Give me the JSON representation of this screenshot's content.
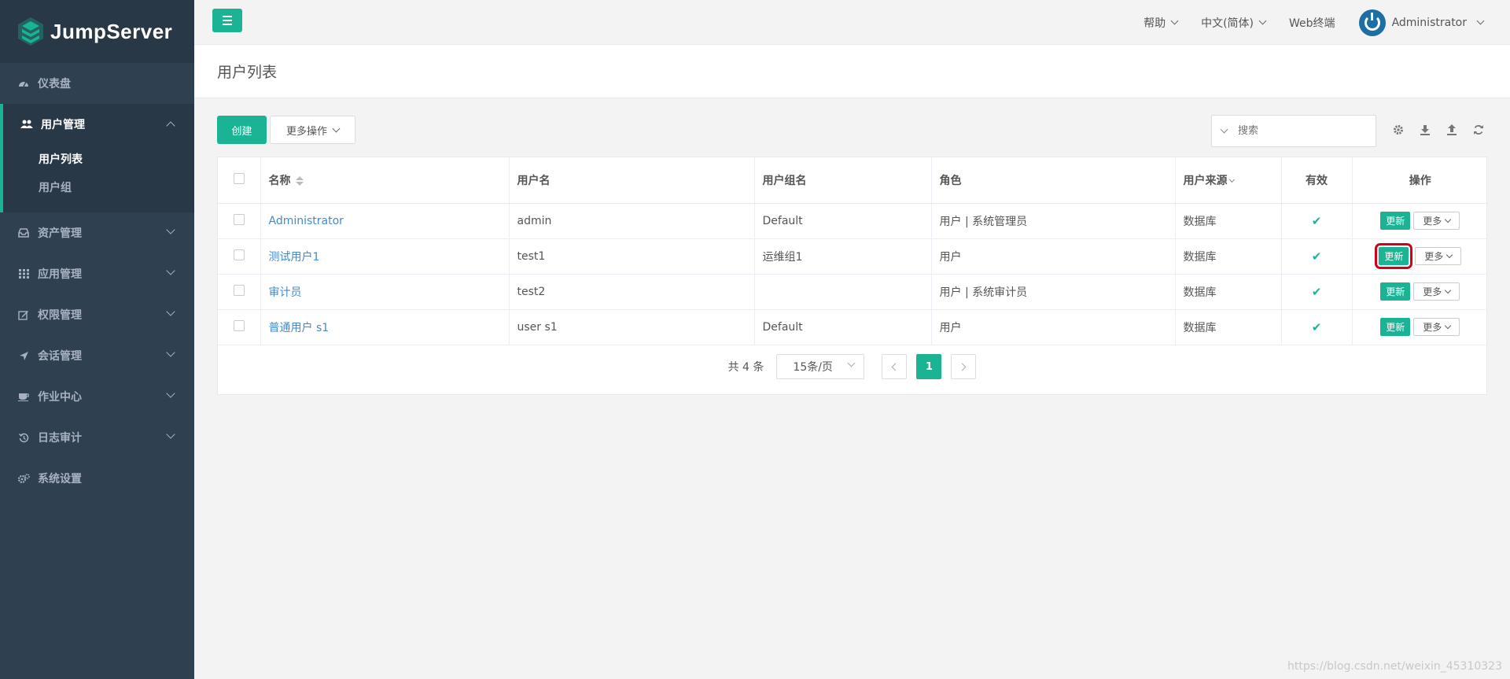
{
  "brand": {
    "name": "JumpServer"
  },
  "sidebar": {
    "items": [
      {
        "label": "仪表盘",
        "icon": "dashboard-icon"
      },
      {
        "label": "用户管理",
        "icon": "users-icon",
        "open": true,
        "children": [
          {
            "label": "用户列表",
            "active": true
          },
          {
            "label": "用户组"
          }
        ]
      },
      {
        "label": "资产管理",
        "icon": "inbox-icon"
      },
      {
        "label": "应用管理",
        "icon": "grid-icon"
      },
      {
        "label": "权限管理",
        "icon": "edit-icon"
      },
      {
        "label": "会话管理",
        "icon": "rocket-icon"
      },
      {
        "label": "作业中心",
        "icon": "coffee-icon"
      },
      {
        "label": "日志审计",
        "icon": "history-icon"
      },
      {
        "label": "系统设置",
        "icon": "cogs-icon"
      }
    ]
  },
  "topbar": {
    "help": "帮助",
    "language": "中文(简体)",
    "web_terminal": "Web终端",
    "user": "Administrator"
  },
  "page": {
    "title": "用户列表"
  },
  "toolbar": {
    "create": "创建",
    "more_actions": "更多操作",
    "search_placeholder": "搜索",
    "icons": [
      "gear-icon",
      "download-icon",
      "upload-icon",
      "refresh-icon"
    ]
  },
  "table": {
    "columns": [
      "名称",
      "用户名",
      "用户组名",
      "角色",
      "用户来源",
      "有效",
      "操作"
    ],
    "rows": [
      {
        "name": "Administrator",
        "username": "admin",
        "group": "Default",
        "role": "用户 | 系统管理员",
        "source": "数据库",
        "valid": "✔"
      },
      {
        "name": "测试用户1",
        "username": "test1",
        "group": "运维组1",
        "role": "用户",
        "source": "数据库",
        "valid": "✔"
      },
      {
        "name": "审计员",
        "username": "test2",
        "group": "",
        "role": "用户 | 系统审计员",
        "source": "数据库",
        "valid": "✔"
      },
      {
        "name": "普通用户 s1",
        "username": "user s1",
        "group": "Default",
        "role": "用户",
        "source": "数据库",
        "valid": "✔"
      }
    ],
    "update_label": "更新",
    "more_label": "更多"
  },
  "pagination": {
    "total": "共 4 条",
    "page_size": "15条/页",
    "current_page": "1"
  },
  "watermark": "https://blog.csdn.net/weixin_45310323",
  "colors": {
    "accent": "#1ab394",
    "sidebar": "#2f4050",
    "link": "#428bca",
    "highlight": "#d0021b"
  }
}
